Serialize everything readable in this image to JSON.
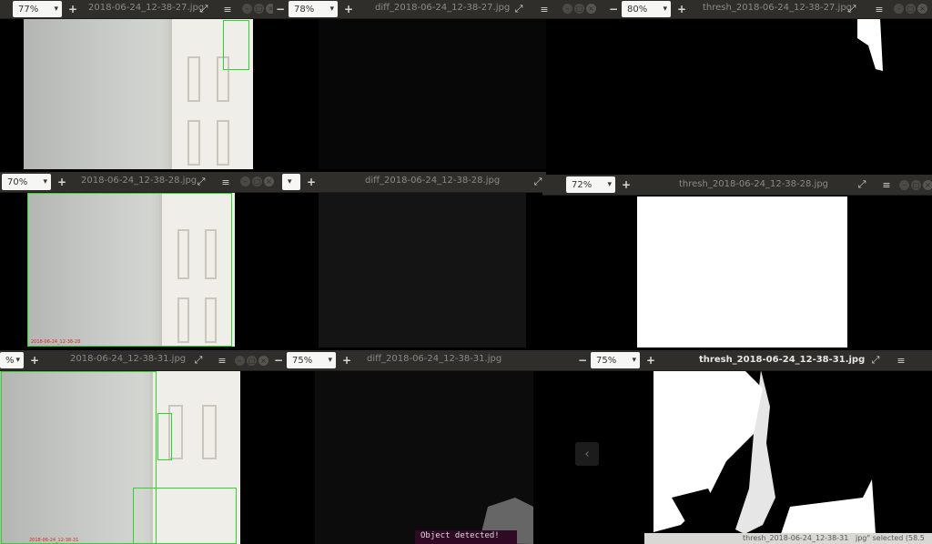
{
  "row1": {
    "left": {
      "zoom": "77%",
      "title": "2018-06-24_12-38-27.jpg"
    },
    "mid": {
      "zoom": "78%",
      "title": "diff_2018-06-24_12-38-27.jpg"
    },
    "right": {
      "zoom": "80%",
      "title": "thresh_2018-06-24_12-38-27.jpg"
    }
  },
  "row2": {
    "left": {
      "zoom": "70%",
      "title": "2018-06-24_12-38-28.jpg",
      "timestamp": "2018-06-24_12-38-28"
    },
    "mid": {
      "title": "diff_2018-06-24_12-38-28.jpg"
    },
    "right": {
      "zoom": "72%",
      "title": "thresh_2018-06-24_12-38-28.jpg"
    }
  },
  "row3": {
    "left": {
      "zoom": "%",
      "title": "2018-06-24_12-38-31.jpg",
      "timestamp": "2018-06-24_12-38-31"
    },
    "mid": {
      "zoom": "75%",
      "title": "diff_2018-06-24_12-38-31.jpg"
    },
    "right": {
      "zoom": "75%",
      "title": "thresh_2018-06-24_12-38-31.jpg"
    }
  },
  "terminal_text": "Object detected!",
  "status_text": "jpg\" selected (58.5",
  "status_fragment": "thresh_2018-06-24_12-38-31"
}
